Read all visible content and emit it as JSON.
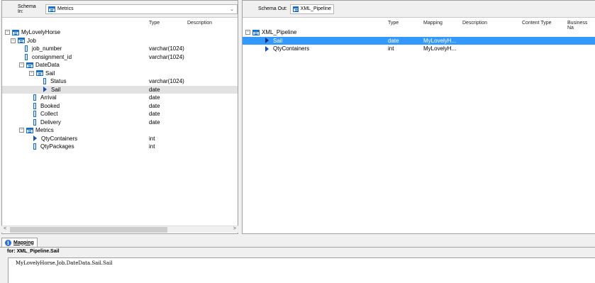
{
  "schema_in": {
    "label": "Schema In:",
    "value": "Metrics"
  },
  "schema_out": {
    "label": "Schema Out:",
    "value": "XML_Pipeline"
  },
  "left_columns": {
    "type": "Type",
    "description": "Description"
  },
  "right_columns": {
    "type": "Type",
    "mapping": "Mapping",
    "description": "Description",
    "content_type": "Content Type",
    "business_name": "Business Na"
  },
  "left_tree": [
    {
      "name": "MyLovelyHorse",
      "type": "",
      "icon": "table-icon",
      "expander": "minus"
    },
    {
      "name": "Job",
      "type": "",
      "icon": "table-icon",
      "expander": "minus"
    },
    {
      "name": "job_number",
      "type": "varchar(1024)",
      "icon": "column-icon"
    },
    {
      "name": "consignment_id",
      "type": "varchar(1024)",
      "icon": "column-icon"
    },
    {
      "name": "DateData",
      "type": "",
      "icon": "table-icon",
      "expander": "minus"
    },
    {
      "name": "Sail",
      "type": "",
      "icon": "table-icon",
      "expander": "minus"
    },
    {
      "name": "Status",
      "type": "varchar(1024)",
      "icon": "column-icon"
    },
    {
      "name": "Sail",
      "type": "date",
      "icon": "mapped-column-icon",
      "selected": true
    },
    {
      "name": "Arrival",
      "type": "date",
      "icon": "column-icon"
    },
    {
      "name": "Booked",
      "type": "date",
      "icon": "column-icon"
    },
    {
      "name": "Collect",
      "type": "date",
      "icon": "column-icon"
    },
    {
      "name": "Delivery",
      "type": "date",
      "icon": "column-icon"
    },
    {
      "name": "Metrics",
      "type": "",
      "icon": "table-icon",
      "expander": "minus"
    },
    {
      "name": "QtyContainers",
      "type": "int",
      "icon": "mapped-column-icon"
    },
    {
      "name": "QtyPackages",
      "type": "int",
      "icon": "column-icon"
    }
  ],
  "right_tree": [
    {
      "name": "XML_Pipeline",
      "type": "",
      "mapping": "",
      "icon": "table-icon",
      "expander": "minus"
    },
    {
      "name": "Sail",
      "type": "date",
      "mapping": "MyLovelyH...",
      "icon": "mapped-column-icon",
      "selected": true
    },
    {
      "name": "QtyContainers",
      "type": "int",
      "mapping": "MyLovelyH...",
      "icon": "mapped-column-icon"
    }
  ],
  "mapping_panel": {
    "tab_label": "Mapping",
    "for_label": "for: XML_Pipeline.Sail",
    "expression": "MyLovelyHorse.Job.DateData.Sail.Sail"
  },
  "colors": {
    "selection_blue": "#3399ff",
    "selection_grey": "#e2e2e2",
    "icon_blue": "#1c6fc4"
  }
}
